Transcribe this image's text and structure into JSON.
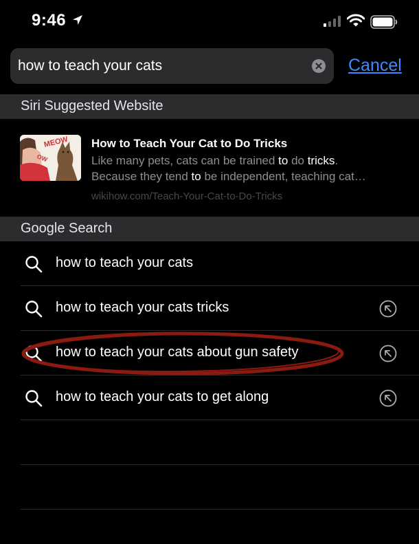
{
  "status_bar": {
    "time": "9:46",
    "location_icon": "location-arrow-icon",
    "signal_icon": "cellular-signal-icon",
    "wifi_icon": "wifi-icon",
    "battery_icon": "battery-icon"
  },
  "search": {
    "value": "how to teach your cats",
    "clear_icon": "clear-icon",
    "cancel_label": "Cancel",
    "accent_color": "#3d8bff"
  },
  "siri_section": {
    "header": "Siri Suggested Website",
    "result": {
      "title": "How to Teach Your Cat to Do Tricks",
      "desc_line1_a": "Like many pets, cats can be trained ",
      "desc_line1_b": "to",
      "desc_line1_c": " do ",
      "desc_line1_d": "tricks",
      "desc_line1_e": ".",
      "desc_line2_a": "Because they tend ",
      "desc_line2_b": "to",
      "desc_line2_c": " be independent, teaching cat…",
      "url": "wikihow.com/Teach-Your-Cat-to-Do-Tricks",
      "thumbnail_text1": "MEOW",
      "thumbnail_text2": "OW"
    }
  },
  "google_section": {
    "header": "Google Search",
    "suggestions": [
      {
        "label": "how to teach your cats",
        "has_fill_arrow": false
      },
      {
        "label": "how to teach your cats tricks",
        "has_fill_arrow": true
      },
      {
        "label": "how to teach your cats about gun safety",
        "has_fill_arrow": true
      },
      {
        "label": "how to teach your cats to get along",
        "has_fill_arrow": true
      }
    ]
  },
  "annotation": {
    "color": "#8b1a10"
  }
}
